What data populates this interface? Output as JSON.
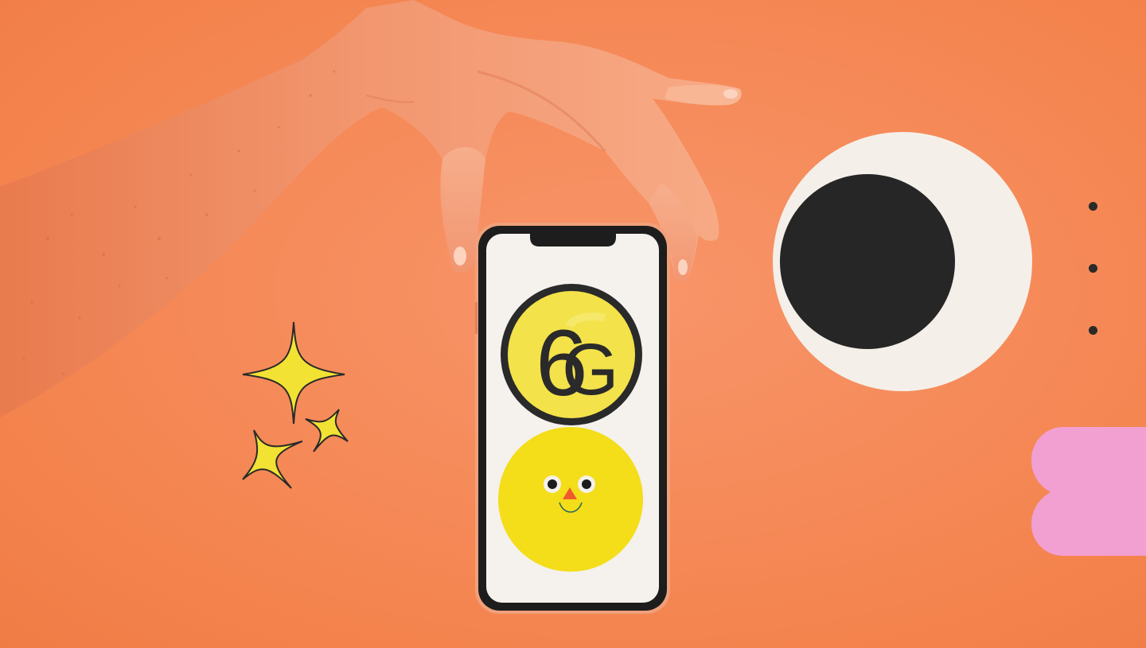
{
  "scene": {
    "colors": {
      "background": "#f58a55",
      "skin": "#f7a07a",
      "phone_frame": "#1d1d1d",
      "screen": "#f5f1ec",
      "badge_yellow": "#f3e24a",
      "face_yellow": "#f4dd19",
      "eclipse_light": "#f5efe9",
      "eclipse_dark": "#262626",
      "pink": "#f2a0d2",
      "sparkle": "#f2e234"
    },
    "badge": {
      "glyph_left": "6",
      "glyph_right": "G"
    },
    "icons": [
      "hand-arm",
      "smartphone",
      "6g-badge-icon",
      "smiley-face-icon",
      "sparkle-icon",
      "eclipse-circle",
      "dot",
      "pink-blob"
    ]
  }
}
